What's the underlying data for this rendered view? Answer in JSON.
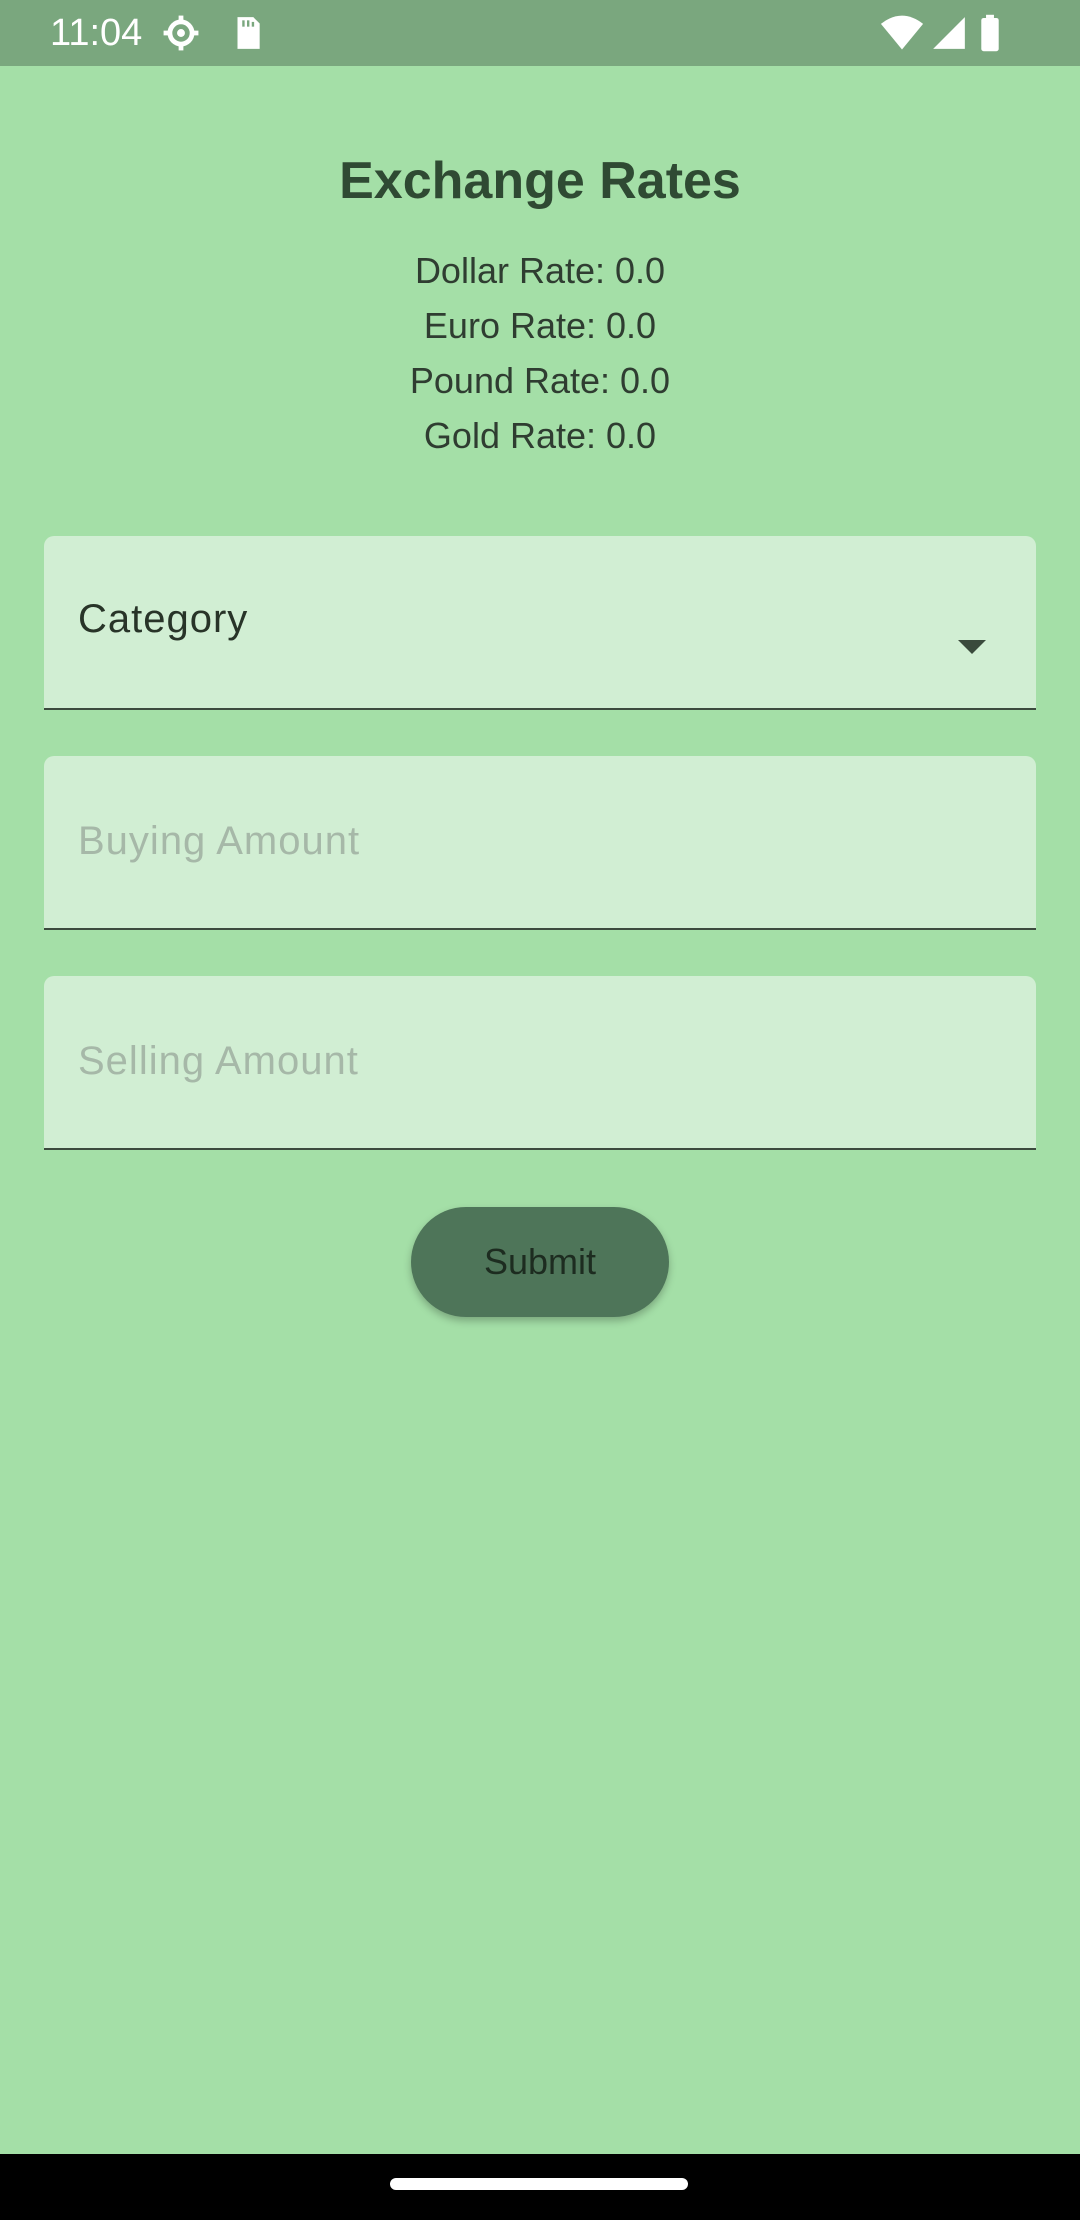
{
  "status_bar": {
    "time": "11:04",
    "icons": [
      "settings-gear-icon",
      "sd-card-icon",
      "wifi-icon",
      "signal-icon",
      "battery-icon"
    ],
    "background": "#7aa77e"
  },
  "screen": {
    "title": "Exchange Rates",
    "rates": [
      "Dollar Rate: 0.0",
      "Euro Rate: 0.0",
      "Pound Rate: 0.0",
      "Gold Rate: 0.0"
    ],
    "category_field": {
      "label": "Category",
      "icon": "dropdown-arrow-icon"
    },
    "buying_field": {
      "placeholder": "Buying Amount"
    },
    "selling_field": {
      "placeholder": "Selling Amount"
    },
    "submit_label": "Submit"
  },
  "colors": {
    "background": "#a4dfa7",
    "field_background": "#d1eed3",
    "button_background": "#4e7559",
    "title_text": "#2f4a33"
  }
}
